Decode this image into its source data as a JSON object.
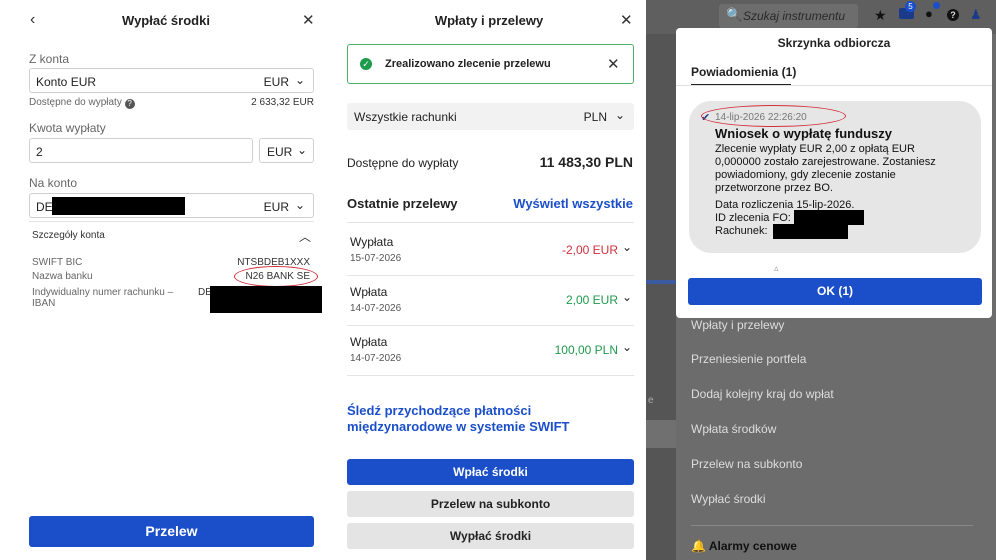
{
  "withdraw": {
    "back_icon": "chevron-left-icon",
    "title": "Wypłać środki",
    "close_icon": "close-icon",
    "from_label": "Z konta",
    "from_value": "Konto EUR",
    "from_currency": "EUR",
    "available_label": "Dostępne do wypłaty",
    "help_icon": "question-circle-icon",
    "available_value": "2 633,32 EUR",
    "amount_label": "Kwota wypłaty",
    "amount_value": "2",
    "amount_currency": "EUR",
    "to_label": "Na konto",
    "to_value": "DE",
    "to_currency": "EUR",
    "details_title": "Szczegóły konta",
    "collapse_icon": "chevron-up-icon",
    "details": [
      {
        "label": "SWIFT BIC",
        "value": "NTSBDEB1XXX"
      },
      {
        "label": "Nazwa banku",
        "value": "N26 BANK SE"
      },
      {
        "label": "Indywidualny numer rachunku – IBAN",
        "value": "DE"
      }
    ],
    "submit": "Przelew"
  },
  "transfers": {
    "title": "Wpłaty i przelewy",
    "close_icon": "close-icon",
    "success_icon": "check-circle-icon",
    "success_message": "Zrealizowano zlecenie przelewu",
    "account_select": "Wszystkie rachunki",
    "account_currency": "PLN",
    "available_label": "Dostępne do wypłaty",
    "available_value": "11 483,30 PLN",
    "recent_title": "Ostatnie przelewy",
    "view_all": "Wyświetl wszystkie",
    "items": [
      {
        "type": "Wypłata",
        "date": "15-07-2026",
        "amount": "-2,00 EUR",
        "color": "#d0303a"
      },
      {
        "type": "Wpłata",
        "date": "14-07-2026",
        "amount": "2,00 EUR",
        "color": "#1e9a4b"
      },
      {
        "type": "Wpłata",
        "date": "14-07-2026",
        "amount": "100,00 PLN",
        "color": "#1e9a4b"
      }
    ],
    "swift_link": "Śledź przychodzące płatności międzynarodowe w systemie SWIFT",
    "btn_deposit": "Wpłać środki",
    "btn_subaccount": "Przelew na subkonto",
    "btn_withdraw": "Wypłać środki"
  },
  "inbox": {
    "search_placeholder": "Szukaj instrumentu",
    "mail_badge": "5",
    "title": "Skrzynka odbiorcza",
    "tab": "Powiadomienia (1)",
    "message": {
      "timestamp": "14-lip-2026 22:26:20",
      "title": "Wniosek o wypłatę funduszy",
      "body": "Zlecenie wypłaty EUR 2,00 z opłatą EUR 0,000000 zostało zarejestrowane. Zostaniesz powiadomiony, gdy zlecenie zostanie przetworzone przez BO.",
      "settlement": "Data rozliczenia 15-lip-2026.",
      "order_id_label": "ID zlecenia FO:",
      "account_label": "Rachunek:"
    },
    "ok_button": "OK (1)",
    "menu": [
      "Wpłaty i przelewy",
      "Przeniesienie portfela",
      "Dodaj kolejny kraj do wpłat",
      "Wpłata środków",
      "Przelew na subkonto",
      "Wypłać środki"
    ],
    "alerts": "Alarmy cenowe",
    "side_letter": "e"
  }
}
